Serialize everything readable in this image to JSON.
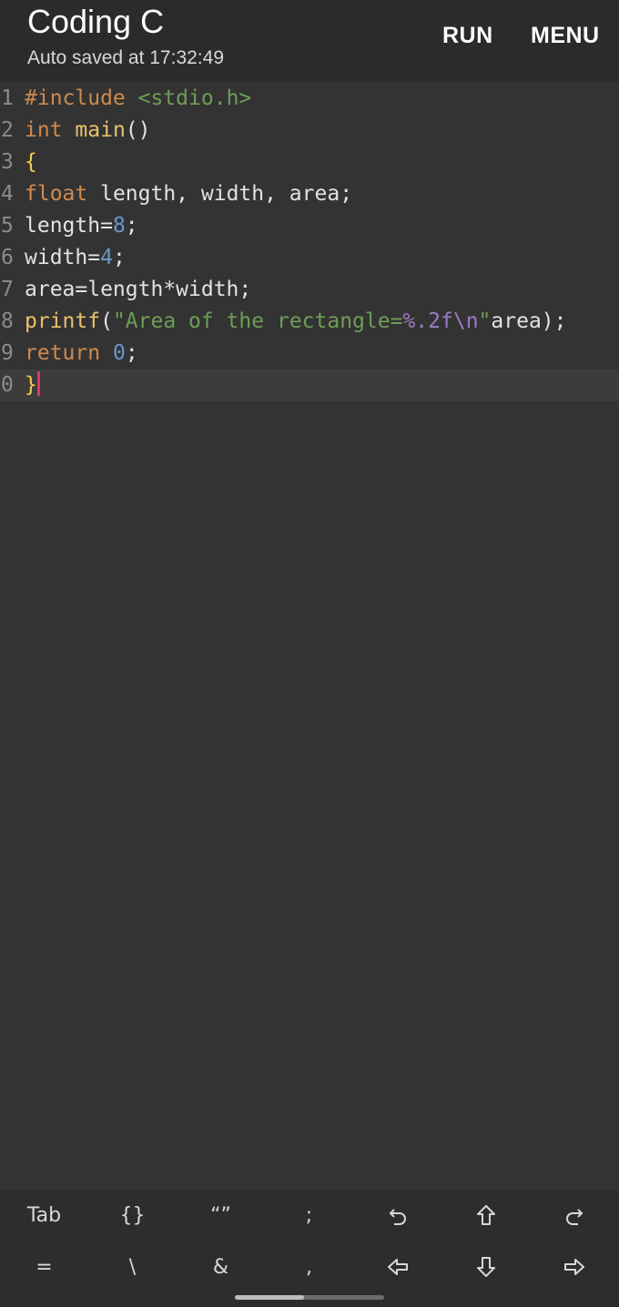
{
  "appbar": {
    "title": "Coding C",
    "subtitle": "Auto saved at 17:32:49",
    "run_label": "RUN",
    "menu_label": "MENU"
  },
  "editor": {
    "line_numbers": [
      "1",
      "2",
      "3",
      "4",
      "5",
      "6",
      "7",
      "8",
      "9",
      "0"
    ],
    "lines": [
      [
        {
          "t": "#include",
          "c": "pre"
        },
        {
          "t": " ",
          "c": "plain"
        },
        {
          "t": "<stdio.h>",
          "c": "inc"
        }
      ],
      [
        {
          "t": "int",
          "c": "kw"
        },
        {
          "t": " ",
          "c": "plain"
        },
        {
          "t": "main",
          "c": "fn"
        },
        {
          "t": "()",
          "c": "plain"
        }
      ],
      [
        {
          "t": "{",
          "c": "brace"
        }
      ],
      [
        {
          "t": "float",
          "c": "kw"
        },
        {
          "t": " length, width, area;",
          "c": "plain"
        }
      ],
      [
        {
          "t": "length=",
          "c": "plain"
        },
        {
          "t": "8",
          "c": "num"
        },
        {
          "t": ";",
          "c": "plain"
        }
      ],
      [
        {
          "t": "width=",
          "c": "plain"
        },
        {
          "t": "4",
          "c": "num"
        },
        {
          "t": ";",
          "c": "plain"
        }
      ],
      [
        {
          "t": "area=length*width;",
          "c": "plain"
        }
      ],
      [
        {
          "t": "printf",
          "c": "fn"
        },
        {
          "t": "(",
          "c": "plain"
        },
        {
          "t": "\"Area of the rectangle=",
          "c": "str"
        },
        {
          "t": "%.2f\\n",
          "c": "fmt"
        },
        {
          "t": "\"",
          "c": "str"
        },
        {
          "t": "area);",
          "c": "plain"
        }
      ],
      [
        {
          "t": "return",
          "c": "kw"
        },
        {
          "t": " ",
          "c": "plain"
        },
        {
          "t": "0",
          "c": "num"
        },
        {
          "t": ";",
          "c": "plain"
        }
      ],
      [
        {
          "t": "}",
          "c": "brace"
        }
      ]
    ],
    "current_line": 9
  },
  "keys": {
    "row1": [
      {
        "label": "Tab",
        "icon": ""
      },
      {
        "label": "{}",
        "icon": ""
      },
      {
        "label": "“”",
        "icon": ""
      },
      {
        "label": ";",
        "icon": ""
      },
      {
        "label": "",
        "icon": "undo-icon"
      },
      {
        "label": "",
        "icon": "arrow-up-icon"
      },
      {
        "label": "",
        "icon": "redo-icon"
      }
    ],
    "row2": [
      {
        "label": "=",
        "icon": ""
      },
      {
        "label": "\\",
        "icon": ""
      },
      {
        "label": "&",
        "icon": ""
      },
      {
        "label": ",",
        "icon": ""
      },
      {
        "label": "",
        "icon": "arrow-left-icon"
      },
      {
        "label": "",
        "icon": "arrow-down-icon"
      },
      {
        "label": "",
        "icon": "arrow-right-icon"
      }
    ]
  },
  "colors": {
    "background": "#333333",
    "appbar": "#2b2b2b",
    "keyword": "#d08a4f",
    "function": "#e9c26a",
    "string": "#6d9e55",
    "number": "#6a97c9",
    "format": "#9b7cc4",
    "cursor": "#e2336a"
  }
}
